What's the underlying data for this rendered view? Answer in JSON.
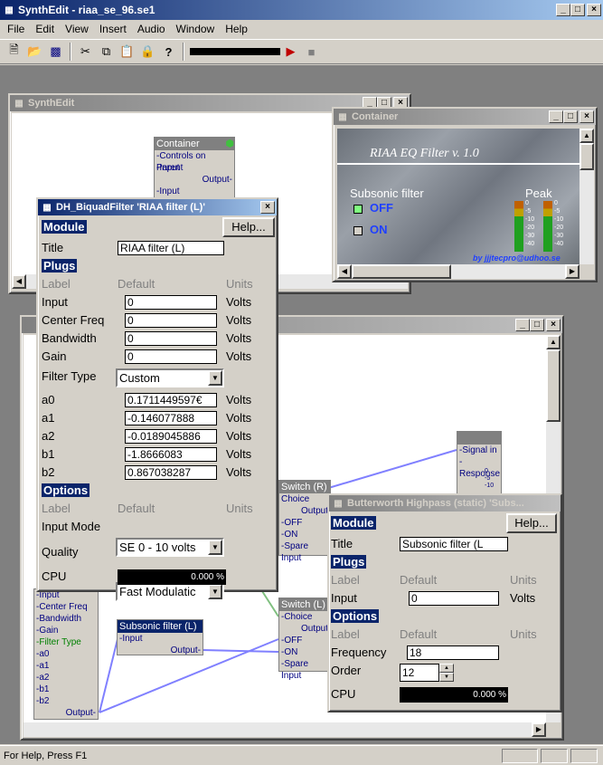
{
  "app": {
    "title": "SynthEdit - riaa_se_96.se1",
    "colors": {
      "title_active": "#0a246a",
      "highlight": "#0a246a"
    }
  },
  "menu": [
    "File",
    "Edit",
    "View",
    "Insert",
    "Audio",
    "Window",
    "Help"
  ],
  "toolbar": {
    "icons": [
      "new-icon",
      "open-icon",
      "save-icon",
      "cut-icon",
      "copy-icon",
      "paste-icon",
      "lock-icon",
      "help-icon",
      "play-icon",
      "stop-icon"
    ],
    "help_glyph": "?"
  },
  "synthedit_child": {
    "title": "SynthEdit"
  },
  "container_module": {
    "title": "Container",
    "plugs": [
      "-Controls on Parent",
      "-Input",
      "Output-",
      "-Input"
    ]
  },
  "container_win": {
    "title": "Container",
    "panel_title": "RIAA EQ Filter v. 1.0",
    "subsonic_label": "Subsonic filter",
    "off_label": "OFF",
    "on_label": "ON",
    "peak_label": "Peak",
    "credit": "by jjjtecpro@udhoo.se",
    "meter_ticks": [
      "0",
      "-5",
      "-10",
      "-20",
      "-30",
      "-40"
    ]
  },
  "biquad": {
    "title": "DH_BiquadFilter 'RIAA filter (L)'",
    "module_label": "Module",
    "help_button": "Help...",
    "title_label": "Title",
    "title_value": "RIAA filter (L)",
    "plugs_label": "Plugs",
    "cols": {
      "label": "Label",
      "default": "Default",
      "units": "Units"
    },
    "plugs": [
      {
        "label": "Input",
        "value": "0",
        "units": "Volts"
      },
      {
        "label": "Center Freq",
        "value": "0",
        "units": "Volts"
      },
      {
        "label": "Bandwidth",
        "value": "0",
        "units": "Volts"
      },
      {
        "label": "Gain",
        "value": "0",
        "units": "Volts"
      }
    ],
    "filter_type_label": "Filter Type",
    "filter_type_value": "Custom",
    "coeffs": [
      {
        "label": "a0",
        "value": "0.1711449597€",
        "units": "Volts"
      },
      {
        "label": "a1",
        "value": "-0.146077888",
        "units": "Volts"
      },
      {
        "label": "a2",
        "value": "-0.0189045886",
        "units": "Volts"
      },
      {
        "label": "b1",
        "value": "-1.8666083",
        "units": "Volts"
      },
      {
        "label": "b2",
        "value": "0.867038287",
        "units": "Volts"
      }
    ],
    "options_label": "Options",
    "input_mode_label": "Input Mode",
    "input_mode_value": "SE 0 - 10 volts",
    "quality_label": "Quality",
    "quality_value": "Fast Modulatic",
    "cpu_label": "CPU",
    "cpu_value": "0.000 %"
  },
  "butterworth": {
    "title": "Butterworth Highpass (static) 'Subs...",
    "module_label": "Module",
    "help_button": "Help...",
    "title_label": "Title",
    "title_value": "Subsonic filter (L",
    "plugs_label": "Plugs",
    "cols": {
      "label": "Label",
      "default": "Default",
      "units": "Units"
    },
    "input_label": "Input",
    "input_value": "0",
    "input_units": "Volts",
    "options_label": "Options",
    "frequency_label": "Frequency",
    "frequency_value": "18",
    "order_label": "Order",
    "order_value": "12",
    "cpu_label": "CPU",
    "cpu_value": "0.000 %"
  },
  "switch_r": {
    "title": "Switch (R)",
    "plugs": [
      "Choice",
      "Output",
      "-OFF",
      "-ON",
      "-Spare Input"
    ]
  },
  "switch_l": {
    "title": "Switch (L)",
    "plugs": [
      "-Choice",
      "Output",
      "-OFF",
      "-ON",
      "-Spare Input"
    ]
  },
  "scope": {
    "plugs": [
      "-Signal in",
      "-Response",
      "0",
      "-5",
      "-10"
    ]
  },
  "biquad_module": {
    "plugs": [
      "-Input",
      "-Center Freq",
      "-Bandwidth",
      "-Gain",
      "-Filter Type",
      "-a0",
      "-a1",
      "-a2",
      "-b1",
      "-b2",
      "Output-"
    ]
  },
  "subsonic_module": {
    "title": "Subsonic filter (L)",
    "plugs": [
      "-Input",
      "Output-"
    ]
  },
  "status": {
    "text": "For Help, Press F1"
  }
}
